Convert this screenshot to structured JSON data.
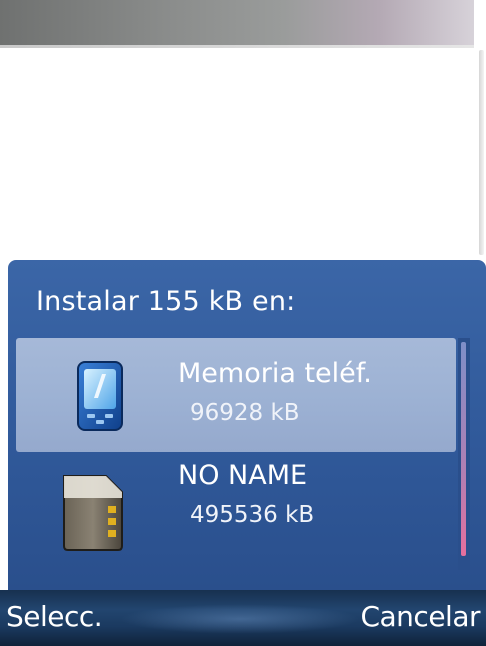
{
  "dialog": {
    "title": "Instalar 155 kB en:",
    "items": [
      {
        "name": "Memoria teléf.",
        "size": "96928 kB",
        "icon": "phone-memory-icon",
        "selected": true
      },
      {
        "name": "NO NAME",
        "size": "495536 kB",
        "icon": "memory-card-icon",
        "selected": false
      }
    ]
  },
  "softkeys": {
    "left_label": "Selecc.",
    "right_label": "Cancelar"
  },
  "colors": {
    "dialog_bg": "#3b66a7",
    "selected_bg": "#a6b9d8",
    "softkey_bar": "#1b3a60"
  }
}
